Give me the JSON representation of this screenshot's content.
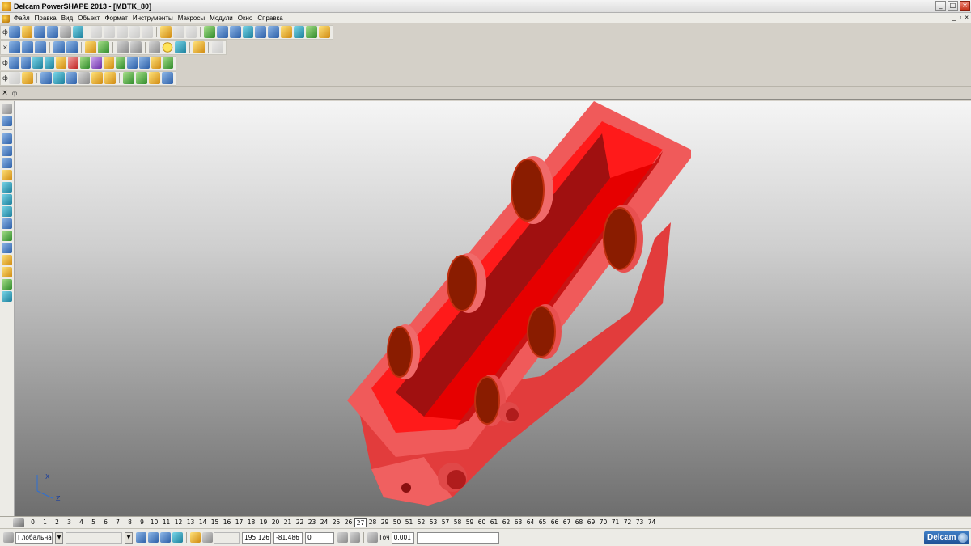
{
  "window": {
    "title": "Delcam PowerSHAPE 2013 - [MBTK_80]",
    "controls": {
      "minimize": "_",
      "maximize": "□",
      "close": "×"
    },
    "mdi_controls": {
      "minimize": "_",
      "restore": "▫",
      "close": "×"
    }
  },
  "menu": {
    "items": [
      "Файл",
      "Правка",
      "Вид",
      "Объект",
      "Формат",
      "Инструменты",
      "Макросы",
      "Модули",
      "Окно",
      "Справка"
    ]
  },
  "mode_bar": {
    "close": "×",
    "pin": "ф"
  },
  "levels": {
    "numbers": [
      "0",
      "1",
      "2",
      "3",
      "4",
      "5",
      "6",
      "7",
      "8",
      "9",
      "10",
      "11",
      "12",
      "13",
      "14",
      "15",
      "16",
      "17",
      "18",
      "19",
      "20",
      "21",
      "22",
      "23",
      "24",
      "25",
      "26",
      "27",
      "28",
      "29",
      "50",
      "51",
      "52",
      "53",
      "57",
      "58",
      "59",
      "60",
      "61",
      "62",
      "63",
      "64",
      "65",
      "66",
      "67",
      "68",
      "69",
      "70",
      "71",
      "72",
      "73",
      "74"
    ],
    "active": "27"
  },
  "statusbar": {
    "workplane": "Глобальна",
    "coord_x": "195.126",
    "coord_y": "-81.486",
    "coord_z": "0",
    "tolerance_label": "Точ",
    "tolerance": "0.001",
    "brand": "Delcam"
  },
  "axes": {
    "x": "X",
    "z": "Z"
  },
  "colors": {
    "model_outer": "#f05a5a",
    "model_inner": "#ff1a1a",
    "model_shadow": "#b81818",
    "bore_face": "#8a1c00"
  }
}
